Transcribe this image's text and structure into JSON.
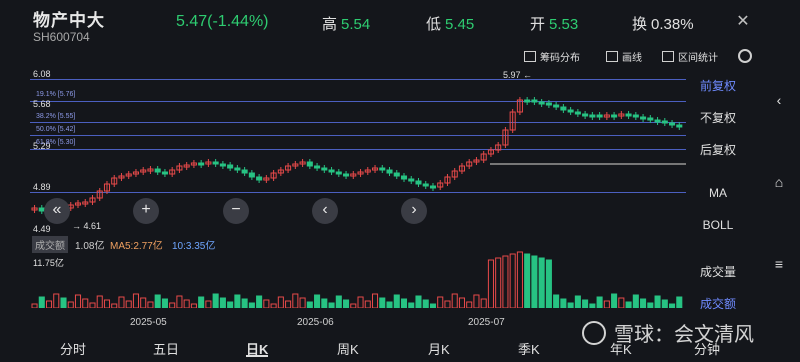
{
  "header": {
    "name": "物产中大",
    "code": "SH600704",
    "price_change": "5.47(-1.44%)",
    "high_label": "高",
    "high": "5.54",
    "low_label": "低",
    "low": "5.45",
    "open_label": "开",
    "open": "5.53",
    "turnover_label": "换",
    "turnover": "0.38%",
    "close_icon": "close-icon"
  },
  "toolbar": {
    "chip_distribution": "筹码分布",
    "draw_line": "画线",
    "range_stats": "区间统计",
    "settings_icon": "gear-icon"
  },
  "chart": {
    "max_label": "5.97",
    "min_label": "4.61",
    "levels": [
      "6.08",
      "5.68",
      "5.29",
      "4.89",
      "4.49"
    ],
    "fib_labels": [
      "19.1% [5.76]",
      "38.2% [5.55]",
      "50.0% [5.42]",
      "61.8% [5.30]"
    ],
    "colors": {
      "up": "#e84a4a",
      "down": "#27c383",
      "fib": "#4b5fc0"
    }
  },
  "nav": {
    "left2": "«",
    "zoom_in": "+",
    "zoom_out": "−",
    "prev": "‹",
    "next": "›"
  },
  "right_panel": {
    "front_adjust": "前复权",
    "no_adjust": "不复权",
    "back_adjust": "后复权",
    "ma": "MA",
    "boll": "BOLL",
    "volume": "成交量",
    "amount": "成交额"
  },
  "volume": {
    "tag": "成交额",
    "value": "1.08亿",
    "ma5": "MA5:2.77亿",
    "ma10": "10:3.35亿",
    "max": "11.75亿"
  },
  "dates": [
    "2025-05",
    "2025-06",
    "2025-07"
  ],
  "tabs": [
    "分时",
    "五日",
    "日K",
    "周K",
    "月K",
    "季K",
    "年K",
    "分钟"
  ],
  "watermark": "雪球：会文清风"
}
